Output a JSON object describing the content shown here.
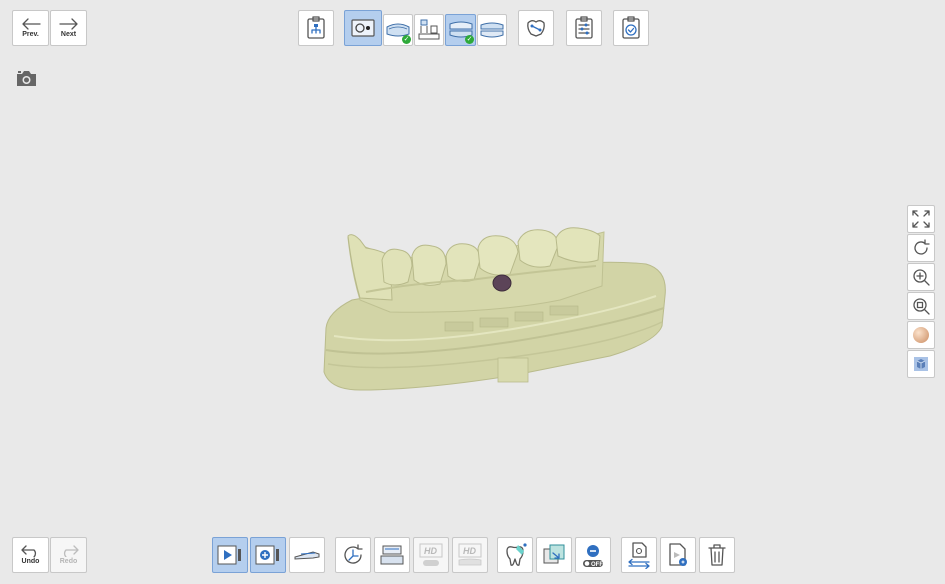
{
  "navigation": {
    "prev_label": "Prev.",
    "next_label": "Next"
  },
  "history": {
    "undo_label": "Undo",
    "redo_label": "Redo"
  },
  "top_toolbar": {
    "items": [
      {
        "name": "order-info-button",
        "icon": "clipboard-flow-icon",
        "state": "normal"
      },
      {
        "name": "maxilla-scan-stage-button",
        "icon": "scan-stage-icon",
        "state": "selected"
      },
      {
        "name": "mandible-scan-stage-button",
        "icon": "arch-icon",
        "state": "done"
      },
      {
        "name": "die-scan-stage-button",
        "icon": "die-icon",
        "state": "normal"
      },
      {
        "name": "occlusion-scan-stage-button",
        "icon": "occlusion-icon",
        "state": "selected-done"
      },
      {
        "name": "alignment-stage-button",
        "icon": "arch-top-icon",
        "state": "normal"
      },
      {
        "name": "margin-tool-button",
        "icon": "margin-icon",
        "state": "normal"
      },
      {
        "name": "settings-button",
        "icon": "sliders-icon",
        "state": "normal"
      },
      {
        "name": "complete-button",
        "icon": "clipboard-check-icon",
        "state": "normal"
      }
    ]
  },
  "view_tools": {
    "items": [
      {
        "name": "fit-view-button",
        "icon": "expand-icon"
      },
      {
        "name": "rotate-view-button",
        "icon": "rotate-icon"
      },
      {
        "name": "zoom-in-button",
        "icon": "zoom-in-icon"
      },
      {
        "name": "zoom-fit-button",
        "icon": "zoom-fit-icon"
      },
      {
        "name": "texture-button",
        "icon": "sphere-icon"
      },
      {
        "name": "view-cube-button",
        "icon": "cube-icon"
      }
    ]
  },
  "bottom_toolbar": {
    "items": [
      {
        "name": "start-scan-button",
        "icon": "play-icon",
        "state": "selected"
      },
      {
        "name": "add-scan-button",
        "icon": "add-scan-icon",
        "state": "selected"
      },
      {
        "name": "scan-area-button",
        "icon": "scan-area-icon",
        "state": "normal"
      },
      {
        "name": "rescan-button",
        "icon": "rotate-axis-icon",
        "state": "normal"
      },
      {
        "name": "trim-button",
        "icon": "trim-icon",
        "state": "normal"
      },
      {
        "name": "hd-off-button",
        "icon": "hd-off-icon",
        "state": "disabled"
      },
      {
        "name": "hd-arch-button",
        "icon": "hd-arch-icon",
        "state": "disabled"
      },
      {
        "name": "tooth-mode-button",
        "icon": "tooth-icon",
        "state": "normal"
      },
      {
        "name": "region-button",
        "icon": "region-icon",
        "state": "normal"
      },
      {
        "name": "delete-off-button",
        "icon": "minus-off-icon",
        "state": "normal"
      },
      {
        "name": "transfer-settings-button",
        "icon": "file-swap-icon",
        "state": "normal"
      },
      {
        "name": "file-edit-button",
        "icon": "file-edit-icon",
        "state": "normal"
      },
      {
        "name": "delete-button",
        "icon": "trash-icon",
        "state": "normal"
      }
    ]
  },
  "viewport": {
    "model": "dental-cast-model",
    "model_color": "#d8dab0",
    "marker_color": "#5c4458"
  }
}
